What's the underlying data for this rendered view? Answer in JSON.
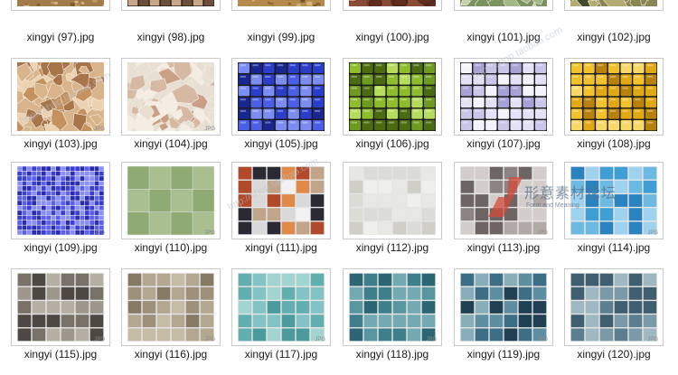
{
  "files": [
    {
      "name": "xingyi (97).jpg",
      "pattern": "speckled",
      "colors": [
        "#a27b4a",
        "#c39a63",
        "#7c5a32",
        "#d8b885"
      ]
    },
    {
      "name": "xingyi (98).jpg",
      "pattern": "checker",
      "colors": [
        "#6d4e3b",
        "#c9a88a",
        "#3e2b20",
        "#e2cbb4"
      ]
    },
    {
      "name": "xingyi (99).jpg",
      "pattern": "speckled",
      "colors": [
        "#b48a4f",
        "#8a6530",
        "#d7b27b",
        "#6e4f26"
      ]
    },
    {
      "name": "xingyi (100).jpg",
      "pattern": "pebble",
      "colors": [
        "#8a4a36",
        "#b5745d",
        "#5f2d1f",
        "#d49a82"
      ]
    },
    {
      "name": "xingyi (101).jpg",
      "pattern": "crazy",
      "colors": [
        "#7b9360",
        "#a2b888",
        "#5b7143",
        "#c6d2b0"
      ]
    },
    {
      "name": "xingyi (102).jpg",
      "pattern": "crazy",
      "colors": [
        "#8a8652",
        "#b4ab72",
        "#5e5a33",
        "#3f4a2e"
      ]
    },
    {
      "name": "xingyi (103).jpg",
      "pattern": "crazy",
      "colors": [
        "#d9b48a",
        "#c4925f",
        "#ecd2b0",
        "#a8744a"
      ],
      "badge": "JPG"
    },
    {
      "name": "xingyi (104).jpg",
      "pattern": "crazy",
      "colors": [
        "#e8dfd3",
        "#d6b9a3",
        "#f4ede4",
        "#c99f86"
      ],
      "badge": "JPG"
    },
    {
      "name": "xingyi (105).jpg",
      "pattern": "glass",
      "colors": [
        "#2b3ec9",
        "#4b5ee6",
        "#1a2690",
        "#7b8cf2"
      ]
    },
    {
      "name": "xingyi (106).jpg",
      "pattern": "glass",
      "colors": [
        "#6e9a1f",
        "#8ebd2c",
        "#4a6b10",
        "#b5dc5a"
      ]
    },
    {
      "name": "xingyi (107).jpg",
      "pattern": "glass",
      "colors": [
        "#c9c6e8",
        "#e4e1f6",
        "#a7a2d6",
        "#f4f3fb"
      ]
    },
    {
      "name": "xingyi (108).jpg",
      "pattern": "glass",
      "colors": [
        "#e0a812",
        "#f2c22c",
        "#b8820a",
        "#f9d86a"
      ]
    },
    {
      "name": "xingyi (109).jpg",
      "pattern": "fine",
      "colors": [
        "#3a3fd6",
        "#5a5ff0",
        "#2a2db0",
        "#8a8ef7"
      ],
      "badge": "JPG"
    },
    {
      "name": "xingyi (110).jpg",
      "pattern": "check-large",
      "colors": [
        "#8faa73",
        "#a9bf90",
        "#7a9862",
        "#b6c99e"
      ],
      "badge": "JPG"
    },
    {
      "name": "xingyi (111).jpg",
      "pattern": "mixed",
      "colors": [
        "#d9d9d9",
        "#e08a4a",
        "#2a2a35",
        "#f2f2f2",
        "#c0a58a",
        "#b04a2a"
      ]
    },
    {
      "name": "xingyi (112).jpg",
      "pattern": "square",
      "colors": [
        "#dcdcd6",
        "#e8e8e2",
        "#cfcfc8",
        "#f0f0ea"
      ]
    },
    {
      "name": "xingyi (113).jpg",
      "pattern": "square",
      "colors": [
        "#8c8484",
        "#b1a9a6",
        "#6e6464",
        "#d3cecb"
      ],
      "badge": "JPG"
    },
    {
      "name": "xingyi (114).jpg",
      "pattern": "square",
      "colors": [
        "#3f9fd4",
        "#6cb9e2",
        "#2a83be",
        "#9fd2ee"
      ],
      "badge": "JPG"
    },
    {
      "name": "xingyi (115).jpg",
      "pattern": "square",
      "colors": [
        "#777168",
        "#9e978b",
        "#4d4842",
        "#b5aea2"
      ],
      "badge": "JPG"
    },
    {
      "name": "xingyi (116).jpg",
      "pattern": "square",
      "colors": [
        "#9e9079",
        "#b4a78f",
        "#867a64",
        "#c6bba4"
      ],
      "badge": "JPG"
    },
    {
      "name": "xingyi (117).jpg",
      "pattern": "square",
      "colors": [
        "#63afb0",
        "#83c3c3",
        "#4b9a9c",
        "#a2d4d2"
      ],
      "badge": "JPG"
    },
    {
      "name": "xingyi (118).jpg",
      "pattern": "square",
      "colors": [
        "#3f7f8c",
        "#58969f",
        "#2c6673",
        "#73a9b0"
      ],
      "badge": "JPG"
    },
    {
      "name": "xingyi (119).jpg",
      "pattern": "square",
      "colors": [
        "#3c6f86",
        "#5d8ea2",
        "#1f3f52",
        "#87aeb9"
      ],
      "badge": "JPG"
    },
    {
      "name": "xingyi (120).jpg",
      "pattern": "square",
      "colors": [
        "#5c7f8f",
        "#7a9aa7",
        "#3f5f6f",
        "#9fb8c1"
      ],
      "badge": "JPG"
    }
  ],
  "watermark": {
    "title": "形意素材论坛",
    "subtitle": "Form and Meaning",
    "diagonal": "http://shop.taobao.com",
    "accent": "#d24a3a"
  }
}
